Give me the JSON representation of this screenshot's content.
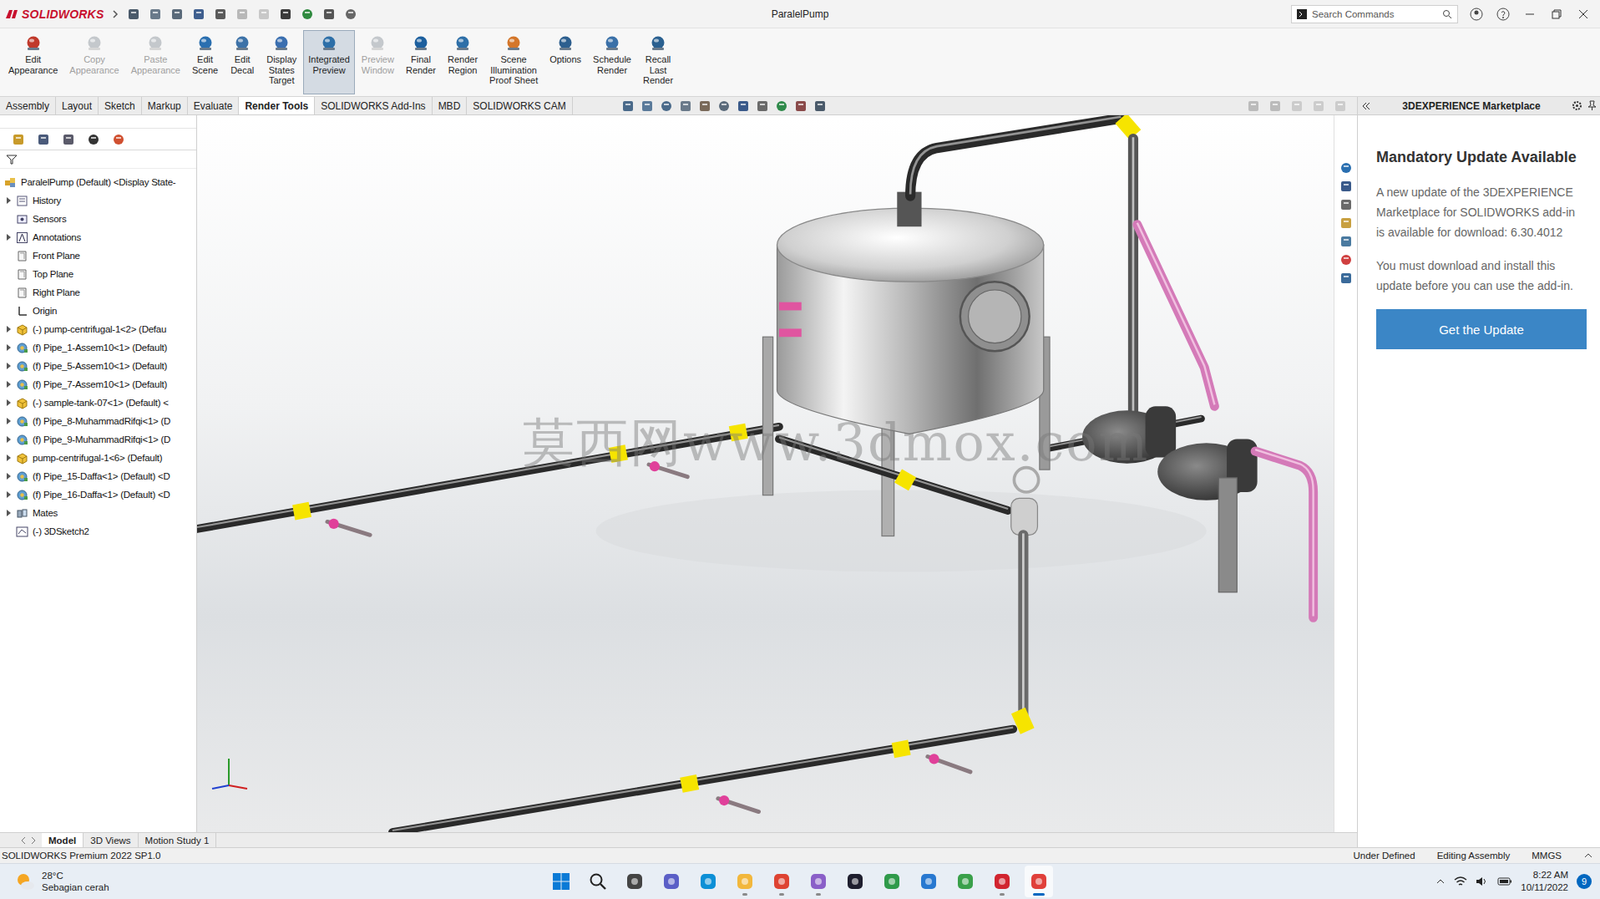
{
  "window": {
    "app": "SOLIDWORKS",
    "title": "ParalelPump",
    "search_placeholder": "Search Commands"
  },
  "ribbon": [
    {
      "lines": [
        "Edit",
        "Appearance"
      ],
      "selected": false,
      "disabled": false
    },
    {
      "lines": [
        "Copy",
        "Appearance"
      ],
      "selected": false,
      "disabled": true
    },
    {
      "lines": [
        "Paste",
        "Appearance"
      ],
      "selected": false,
      "disabled": true
    },
    {
      "lines": [
        "Edit",
        "Scene"
      ],
      "selected": false,
      "disabled": false
    },
    {
      "lines": [
        "Edit",
        "Decal"
      ],
      "selected": false,
      "disabled": false
    },
    {
      "lines": [
        "Display",
        "States",
        "Target"
      ],
      "selected": false,
      "disabled": false
    },
    {
      "lines": [
        "Integrated",
        "Preview"
      ],
      "selected": true,
      "disabled": false
    },
    {
      "lines": [
        "Preview",
        "Window"
      ],
      "selected": false,
      "disabled": true
    },
    {
      "lines": [
        "Final",
        "Render"
      ],
      "selected": false,
      "disabled": false
    },
    {
      "lines": [
        "Render",
        "Region"
      ],
      "selected": false,
      "disabled": false
    },
    {
      "lines": [
        "Scene",
        "Illumination",
        "Proof Sheet"
      ],
      "selected": false,
      "disabled": false
    },
    {
      "lines": [
        "Options"
      ],
      "selected": false,
      "disabled": false
    },
    {
      "lines": [
        "Schedule",
        "Render"
      ],
      "selected": false,
      "disabled": false
    },
    {
      "lines": [
        "Recall",
        "Last",
        "Render"
      ],
      "selected": false,
      "disabled": false
    }
  ],
  "tabs": [
    {
      "label": "Assembly",
      "selected": false
    },
    {
      "label": "Layout",
      "selected": false
    },
    {
      "label": "Sketch",
      "selected": false
    },
    {
      "label": "Markup",
      "selected": false
    },
    {
      "label": "Evaluate",
      "selected": false
    },
    {
      "label": "Render Tools",
      "selected": true
    },
    {
      "label": "SOLIDWORKS Add-Ins",
      "selected": false
    },
    {
      "label": "MBD",
      "selected": false
    },
    {
      "label": "SOLIDWORKS CAM",
      "selected": false
    }
  ],
  "feature_tree": {
    "items": [
      {
        "label": "ParalelPump (Default) <Display State-",
        "kind": "root",
        "expandable": false,
        "expanded": true
      },
      {
        "label": "History",
        "kind": "history",
        "expandable": true,
        "expanded": false
      },
      {
        "label": "Sensors",
        "kind": "sensors",
        "expandable": false,
        "expanded": false
      },
      {
        "label": "Annotations",
        "kind": "annotations",
        "expandable": true,
        "expanded": false
      },
      {
        "label": "Front Plane",
        "kind": "plane",
        "expandable": false,
        "expanded": false
      },
      {
        "label": "Top Plane",
        "kind": "plane",
        "expandable": false,
        "expanded": false
      },
      {
        "label": "Right Plane",
        "kind": "plane",
        "expandable": false,
        "expanded": false
      },
      {
        "label": "Origin",
        "kind": "origin",
        "expandable": false,
        "expanded": false
      },
      {
        "label": "(-) pump-centrifugal-1<2> (Defau",
        "kind": "part",
        "expandable": true,
        "expanded": false
      },
      {
        "label": "(f) Pipe_1-Assem10<1> (Default)",
        "kind": "assembly",
        "expandable": true,
        "expanded": false
      },
      {
        "label": "(f) Pipe_5-Assem10<1> (Default)",
        "kind": "assembly",
        "expandable": true,
        "expanded": false
      },
      {
        "label": "(f) Pipe_7-Assem10<1> (Default)",
        "kind": "assembly",
        "expandable": true,
        "expanded": false
      },
      {
        "label": "(-) sample-tank-07<1> (Default) <",
        "kind": "part",
        "expandable": true,
        "expanded": false
      },
      {
        "label": "(f) Pipe_8-MuhammadRifqi<1> (D",
        "kind": "assembly",
        "expandable": true,
        "expanded": false
      },
      {
        "label": "(f) Pipe_9-MuhammadRifqi<1> (D",
        "kind": "assembly",
        "expandable": true,
        "expanded": false
      },
      {
        "label": "pump-centrifugal-1<6> (Default)",
        "kind": "part",
        "expandable": true,
        "expanded": false
      },
      {
        "label": "(f) Pipe_15-Daffa<1> (Default) <D",
        "kind": "assembly",
        "expandable": true,
        "expanded": false
      },
      {
        "label": "(f) Pipe_16-Daffa<1> (Default) <D",
        "kind": "assembly",
        "expandable": true,
        "expanded": false
      },
      {
        "label": "Mates",
        "kind": "mates",
        "expandable": true,
        "expanded": false
      },
      {
        "label": "(-) 3DSketch2",
        "kind": "sketch",
        "expandable": false,
        "expanded": false
      }
    ]
  },
  "viewport": {
    "watermark": "莫西网www.3dmox.com"
  },
  "bottom_tabs": [
    {
      "label": "Model",
      "selected": true
    },
    {
      "label": "3D Views",
      "selected": false
    },
    {
      "label": "Motion Study 1",
      "selected": false
    }
  ],
  "status_bar": {
    "product": "SOLIDWORKS Premium 2022 SP1.0",
    "state": "Under Defined",
    "mode": "Editing Assembly",
    "units": "MMGS"
  },
  "task_pane": {
    "title": "3DEXPERIENCE Marketplace",
    "heading": "Mandatory Update Available",
    "paragraphs": [
      "A new update of the 3DEXPERIENCE Marketplace for SOLIDWORKS add-in is available for download: 6.30.4012",
      "You must download and install this update before you can use the add-in."
    ],
    "button": "Get the Update"
  },
  "taskbar": {
    "weather": {
      "temp": "28°C",
      "condition": "Sebagian cerah"
    },
    "apps": [
      {
        "running": false,
        "focused": false
      },
      {
        "running": false,
        "focused": false
      },
      {
        "running": false,
        "focused": false
      },
      {
        "running": false,
        "focused": false
      },
      {
        "running": false,
        "focused": false
      },
      {
        "running": true,
        "focused": false
      },
      {
        "running": true,
        "focused": false
      },
      {
        "running": true,
        "focused": false
      },
      {
        "running": false,
        "focused": false
      },
      {
        "running": false,
        "focused": false
      },
      {
        "running": false,
        "focused": false
      },
      {
        "running": false,
        "focused": false
      },
      {
        "running": true,
        "focused": false
      },
      {
        "running": true,
        "focused": true
      }
    ],
    "time": "8:22 AM",
    "date": "10/11/2022",
    "notifications": "9"
  }
}
